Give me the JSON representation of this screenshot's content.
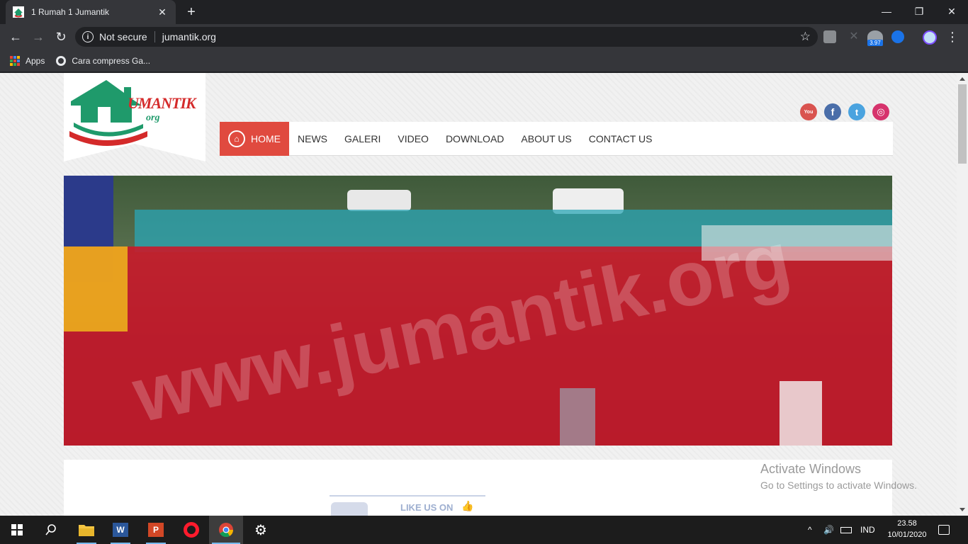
{
  "browser": {
    "tab": {
      "title": "1 Rumah 1 Jumantik",
      "close": "✕"
    },
    "new_tab": "+",
    "window": {
      "minimize": "—",
      "restore": "❐",
      "close": "✕"
    },
    "nav": {
      "back": "←",
      "forward": "→",
      "reload": "↻"
    },
    "omnibox": {
      "info": "i",
      "security": "Not secure",
      "url": "jumantik.org",
      "bookmark_star": "☆"
    },
    "extensions": {
      "badge": "3.97"
    },
    "menu": "⋮",
    "bookmarks": [
      {
        "label": "Apps",
        "icon": "apps-grid-icon"
      },
      {
        "label": "Cara compress Ga...",
        "icon": "globe-icon"
      }
    ]
  },
  "site": {
    "logo": {
      "text": "UMANTIK",
      "sub": "org"
    },
    "social": [
      {
        "name": "youtube",
        "glyph": "You",
        "color": "#d9534f"
      },
      {
        "name": "facebook",
        "glyph": "f",
        "color": "#4a6ea9"
      },
      {
        "name": "twitter",
        "glyph": "t",
        "color": "#4aa3df"
      },
      {
        "name": "instagram",
        "glyph": "◎",
        "color": "#d6336c"
      }
    ],
    "nav": {
      "home": "HOME",
      "items": [
        "NEWS",
        "GALERI",
        "VIDEO",
        "DOWNLOAD",
        "ABOUT US",
        "CONTACT US"
      ]
    },
    "hero_watermark": "www.jumantik.org",
    "fb_widget": {
      "label": "LIKE US ON"
    }
  },
  "overlay": {
    "activate_title": "Activate Windows",
    "activate_sub": "Go to Settings to activate Windows."
  },
  "taskbar": {
    "tray": {
      "chevron": "^",
      "volume": "🔊",
      "language": "IND"
    },
    "clock": {
      "time": "23.58",
      "date": "10/01/2020"
    }
  },
  "colors": {
    "accent": "#e04a3f",
    "chrome_dark": "#202124",
    "chrome_mid": "#35363a",
    "taskbar": "#1c1c1c"
  }
}
